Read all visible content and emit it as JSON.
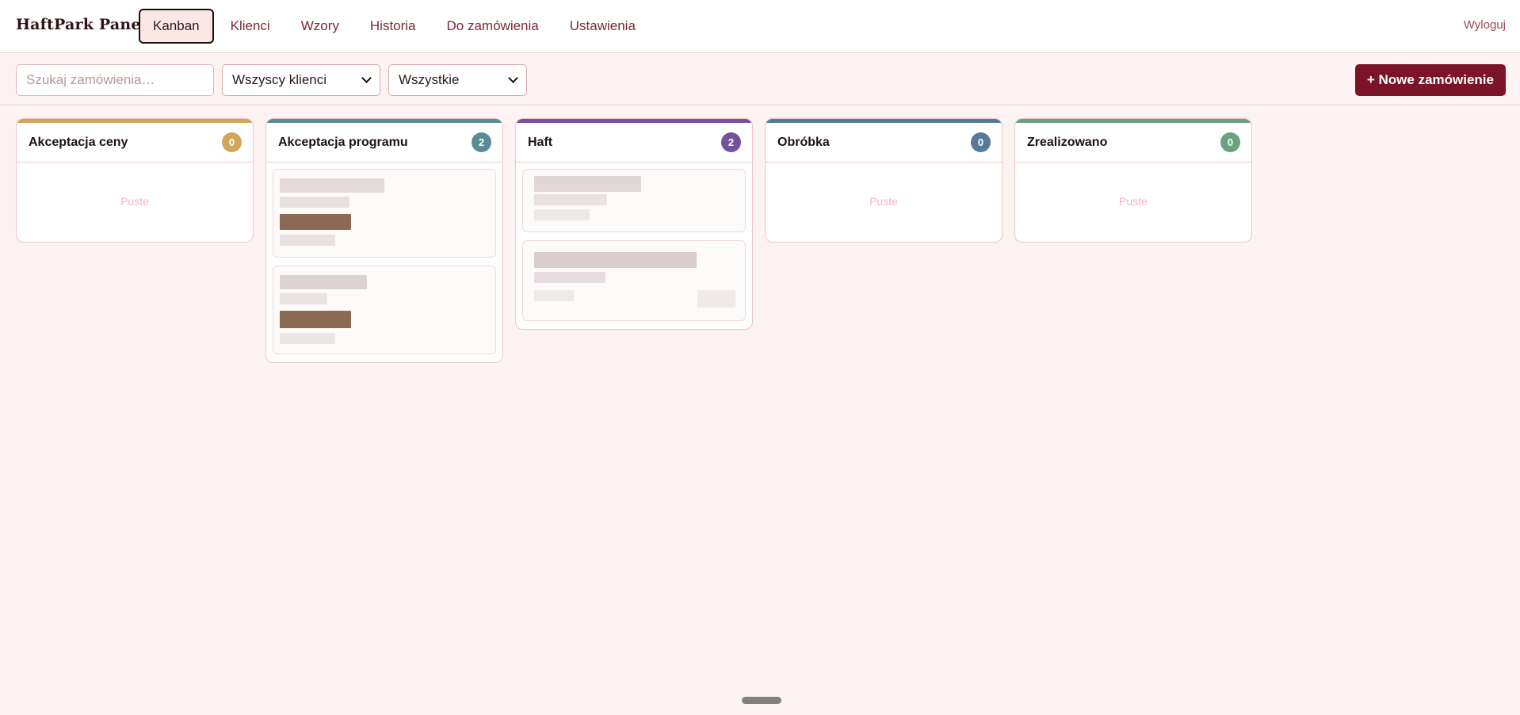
{
  "header": {
    "brand": "HaftPark Panel",
    "nav": [
      {
        "label": "Kanban",
        "active": true
      },
      {
        "label": "Klienci",
        "active": false
      },
      {
        "label": "Wzory",
        "active": false
      },
      {
        "label": "Historia",
        "active": false
      },
      {
        "label": "Do zamówienia",
        "active": false
      },
      {
        "label": "Ustawienia",
        "active": false
      }
    ],
    "logout": "Wyloguj"
  },
  "toolbar": {
    "search_placeholder": "Szukaj zamówienia…",
    "clients_selected": "Wszyscy klienci",
    "status_selected": "Wszystkie",
    "new_order_label": "+ Nowe zamówienie"
  },
  "columns": [
    {
      "title": "Akceptacja ceny",
      "count": "0",
      "color": "#d1a65a",
      "empty_label": "Puste"
    },
    {
      "title": "Akceptacja programu",
      "count": "2",
      "color": "#5a8c96",
      "empty_label": ""
    },
    {
      "title": "Haft",
      "count": "2",
      "color": "#74519b",
      "empty_label": ""
    },
    {
      "title": "Obróbka",
      "count": "0",
      "color": "#537a9a",
      "empty_label": "Puste"
    },
    {
      "title": "Zrealizowano",
      "count": "0",
      "color": "#6aa27e",
      "empty_label": "Puste"
    }
  ],
  "colors": {
    "accent": "#7b1426",
    "background": "#fdf3f2",
    "empty_text": "#efb7c0"
  }
}
